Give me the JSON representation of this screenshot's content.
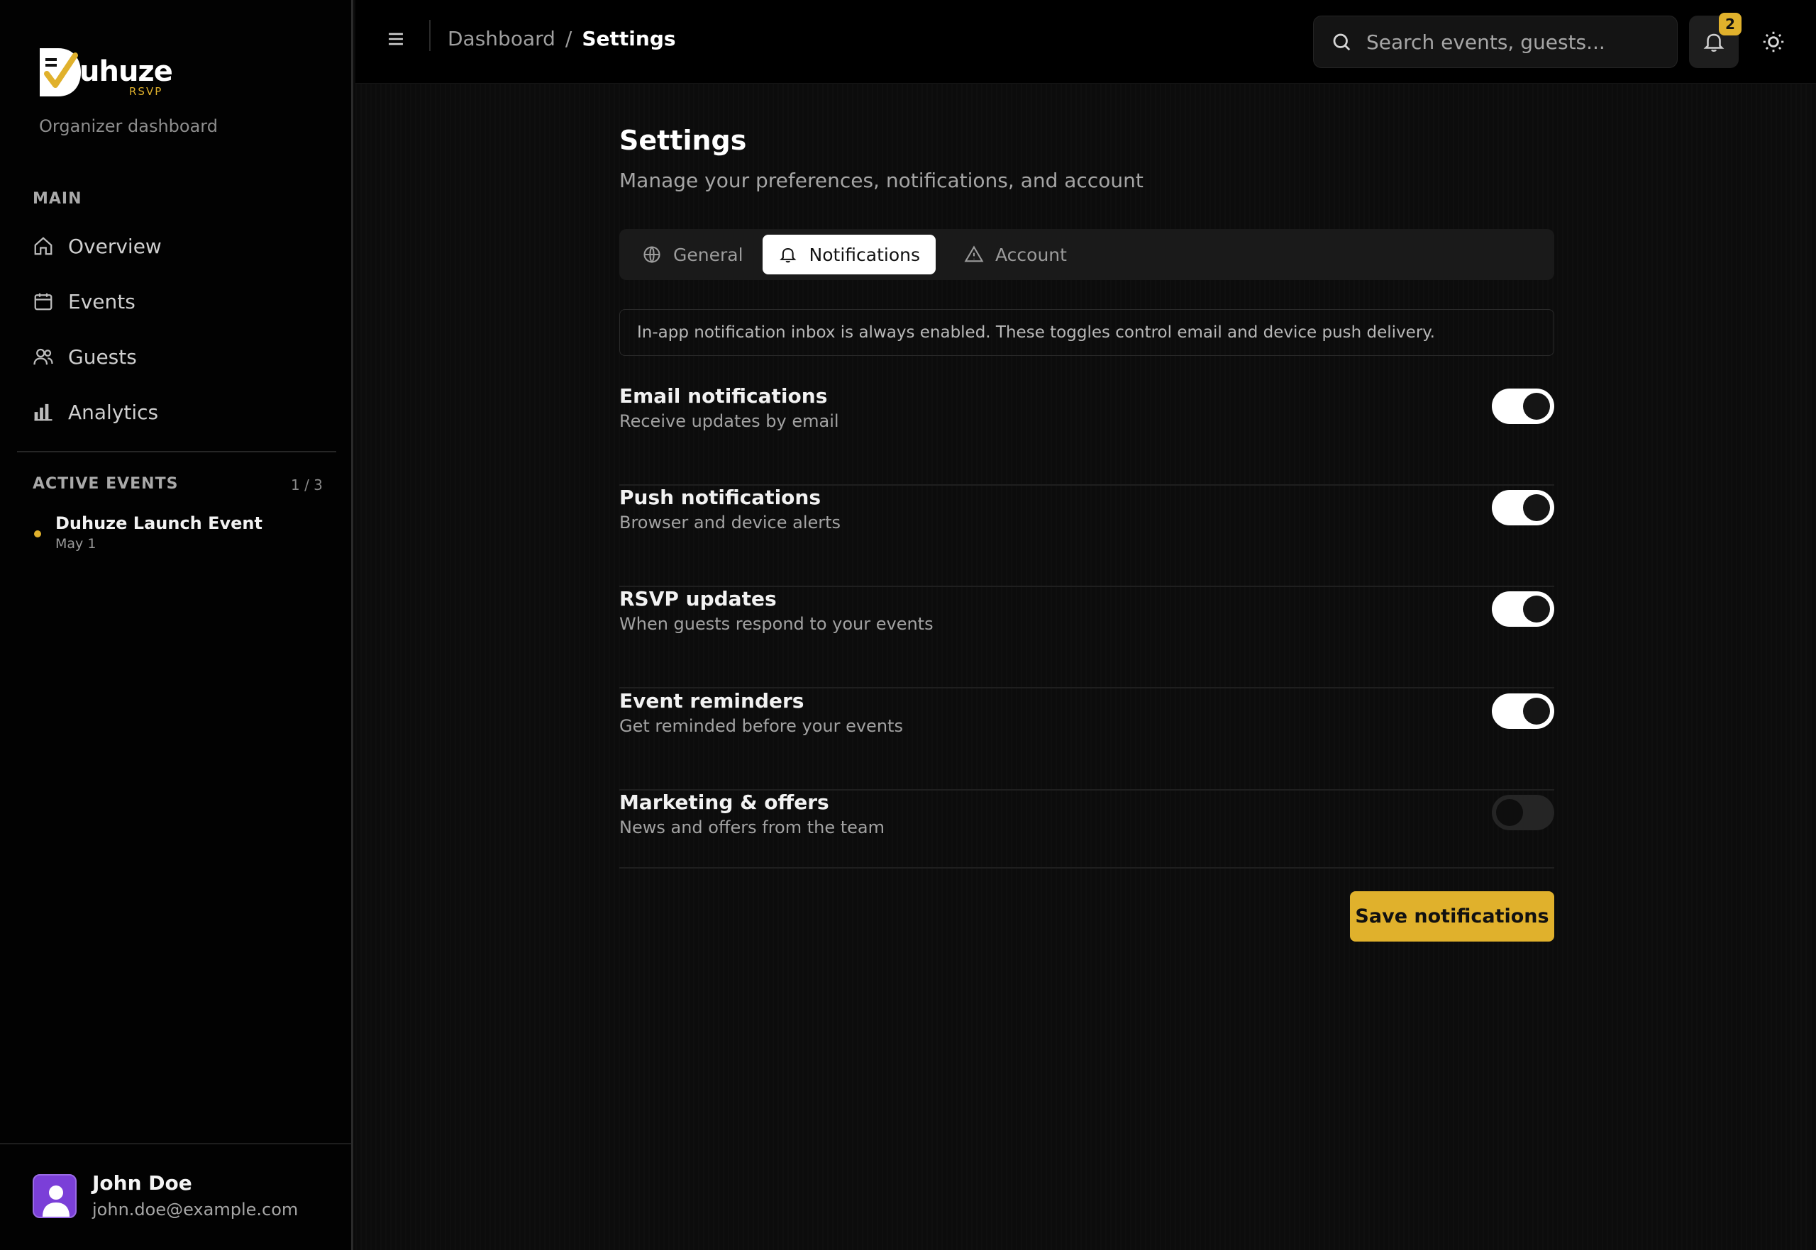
{
  "brand": {
    "name": "uhuze",
    "sub": "RSVP",
    "tagline": "Organizer dashboard",
    "accent": "#e0b12c"
  },
  "sidebar": {
    "main_title": "MAIN",
    "items": [
      {
        "label": "Overview",
        "icon": "home-icon"
      },
      {
        "label": "Events",
        "icon": "calendar-icon"
      },
      {
        "label": "Guests",
        "icon": "users-icon"
      },
      {
        "label": "Analytics",
        "icon": "bar-chart-icon"
      }
    ],
    "active_title": "ACTIVE EVENTS",
    "active_count": "1 / 3",
    "events": [
      {
        "name": "Duhuze Launch Event",
        "date": "May 1"
      }
    ]
  },
  "user": {
    "name": "John Doe",
    "email": "john.doe@example.com"
  },
  "header": {
    "breadcrumb": [
      "Dashboard",
      "/",
      "Settings"
    ],
    "search_placeholder": "Search events, guests...",
    "notification_count": "2"
  },
  "page": {
    "title": "Settings",
    "subtitle": "Manage your preferences, notifications, and account",
    "tabs": [
      {
        "label": "General",
        "icon": "globe-icon",
        "active": false
      },
      {
        "label": "Notifications",
        "icon": "bell-icon",
        "active": true
      },
      {
        "label": "Account",
        "icon": "warning-icon",
        "active": false
      }
    ],
    "notice": "In-app notification inbox is always enabled. These toggles control email and device push delivery.",
    "settings": [
      {
        "label": "Email notifications",
        "desc": "Receive updates by email",
        "on": true
      },
      {
        "label": "Push notifications",
        "desc": "Browser and device alerts",
        "on": true
      },
      {
        "label": "RSVP updates",
        "desc": "When guests respond to your events",
        "on": true
      },
      {
        "label": "Event reminders",
        "desc": "Get reminded before your events",
        "on": true
      },
      {
        "label": "Marketing & offers",
        "desc": "News and offers from the team",
        "on": false
      }
    ],
    "save_label": "Save notifications"
  }
}
